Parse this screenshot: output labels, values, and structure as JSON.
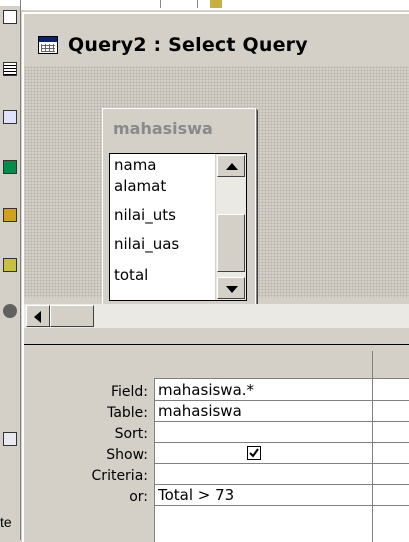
{
  "window": {
    "title": "Query2 : Select Query"
  },
  "table": {
    "name": "mahasiswa",
    "fields": [
      "nama",
      "alamat",
      "nilai_uts",
      "nilai_uas",
      "total"
    ]
  },
  "grid": {
    "row_labels": {
      "field": "Field:",
      "table": "Table:",
      "sort": "Sort:",
      "show": "Show:",
      "criteria": "Criteria:",
      "or": "or:"
    },
    "column1": {
      "field": "mahasiswa.*",
      "table": "mahasiswa",
      "sort": "",
      "show": true,
      "criteria": "Total > 73",
      "or": ""
    }
  },
  "left_strip": {
    "partial_text": "te"
  },
  "colors": {
    "window_face": "#d4d0c8",
    "title_color": "#000000",
    "table_title_gray": "#8a8a8a"
  }
}
